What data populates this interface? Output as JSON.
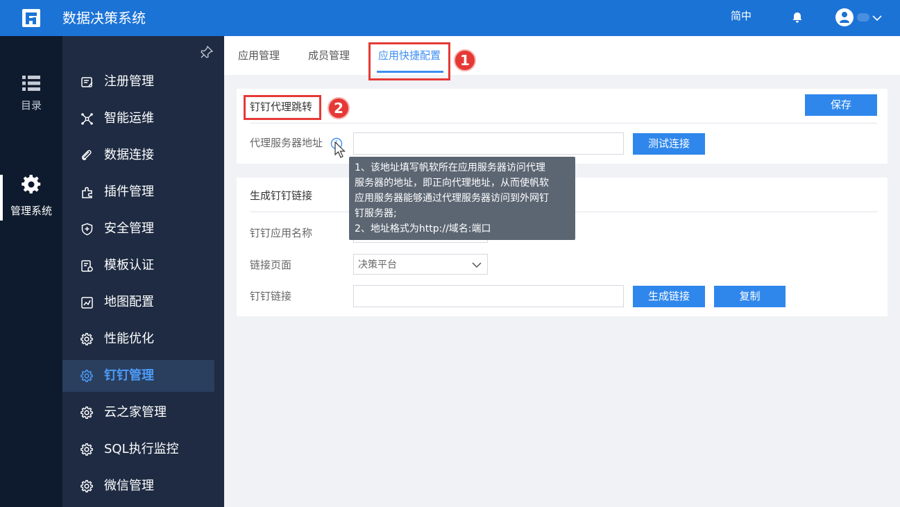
{
  "header": {
    "title": "数据决策系统",
    "language": "简中"
  },
  "rail": {
    "items": [
      {
        "label": "目录"
      },
      {
        "label": "管理系统"
      }
    ]
  },
  "sidebar": {
    "items": [
      {
        "label": "注册管理"
      },
      {
        "label": "智能运维"
      },
      {
        "label": "数据连接"
      },
      {
        "label": "插件管理"
      },
      {
        "label": "安全管理"
      },
      {
        "label": "模板认证"
      },
      {
        "label": "地图配置"
      },
      {
        "label": "性能优化"
      },
      {
        "label": "钉钉管理"
      },
      {
        "label": "云之家管理"
      },
      {
        "label": "SQL执行监控"
      },
      {
        "label": "微信管理"
      }
    ],
    "active_index": 8
  },
  "tabs": [
    {
      "label": "应用管理"
    },
    {
      "label": "成员管理"
    },
    {
      "label": "应用快捷配置"
    }
  ],
  "annotations": {
    "badge1": "1",
    "badge2": "2"
  },
  "proxy_section": {
    "title": "钉钉代理跳转",
    "save_label": "保存",
    "server_label": "代理服务器地址",
    "server_value": "",
    "test_label": "测试连接"
  },
  "tooltip": {
    "lines": [
      "1、该地址填写帆软所在应用服务器访问代理",
      "服务器的地址，即正向代理地址，从而使帆软",
      "应用服务器能够通过代理服务器访问到外网钉",
      "钉服务器;",
      "2、地址格式为http://域名:端口"
    ]
  },
  "link_section": {
    "title": "生成钉钉链接",
    "app_name_label": "钉钉应用名称",
    "page_label": "链接页面",
    "page_value": "决策平台",
    "link_label": "钉钉链接",
    "link_value": "",
    "generate_label": "生成链接",
    "copy_label": "复制"
  },
  "colors": {
    "topbar": "#1c73d6",
    "rail": "#0e1a2d",
    "sidebar": "#1e2b42",
    "accent": "#3d8ef2",
    "annotation": "#e53935"
  }
}
